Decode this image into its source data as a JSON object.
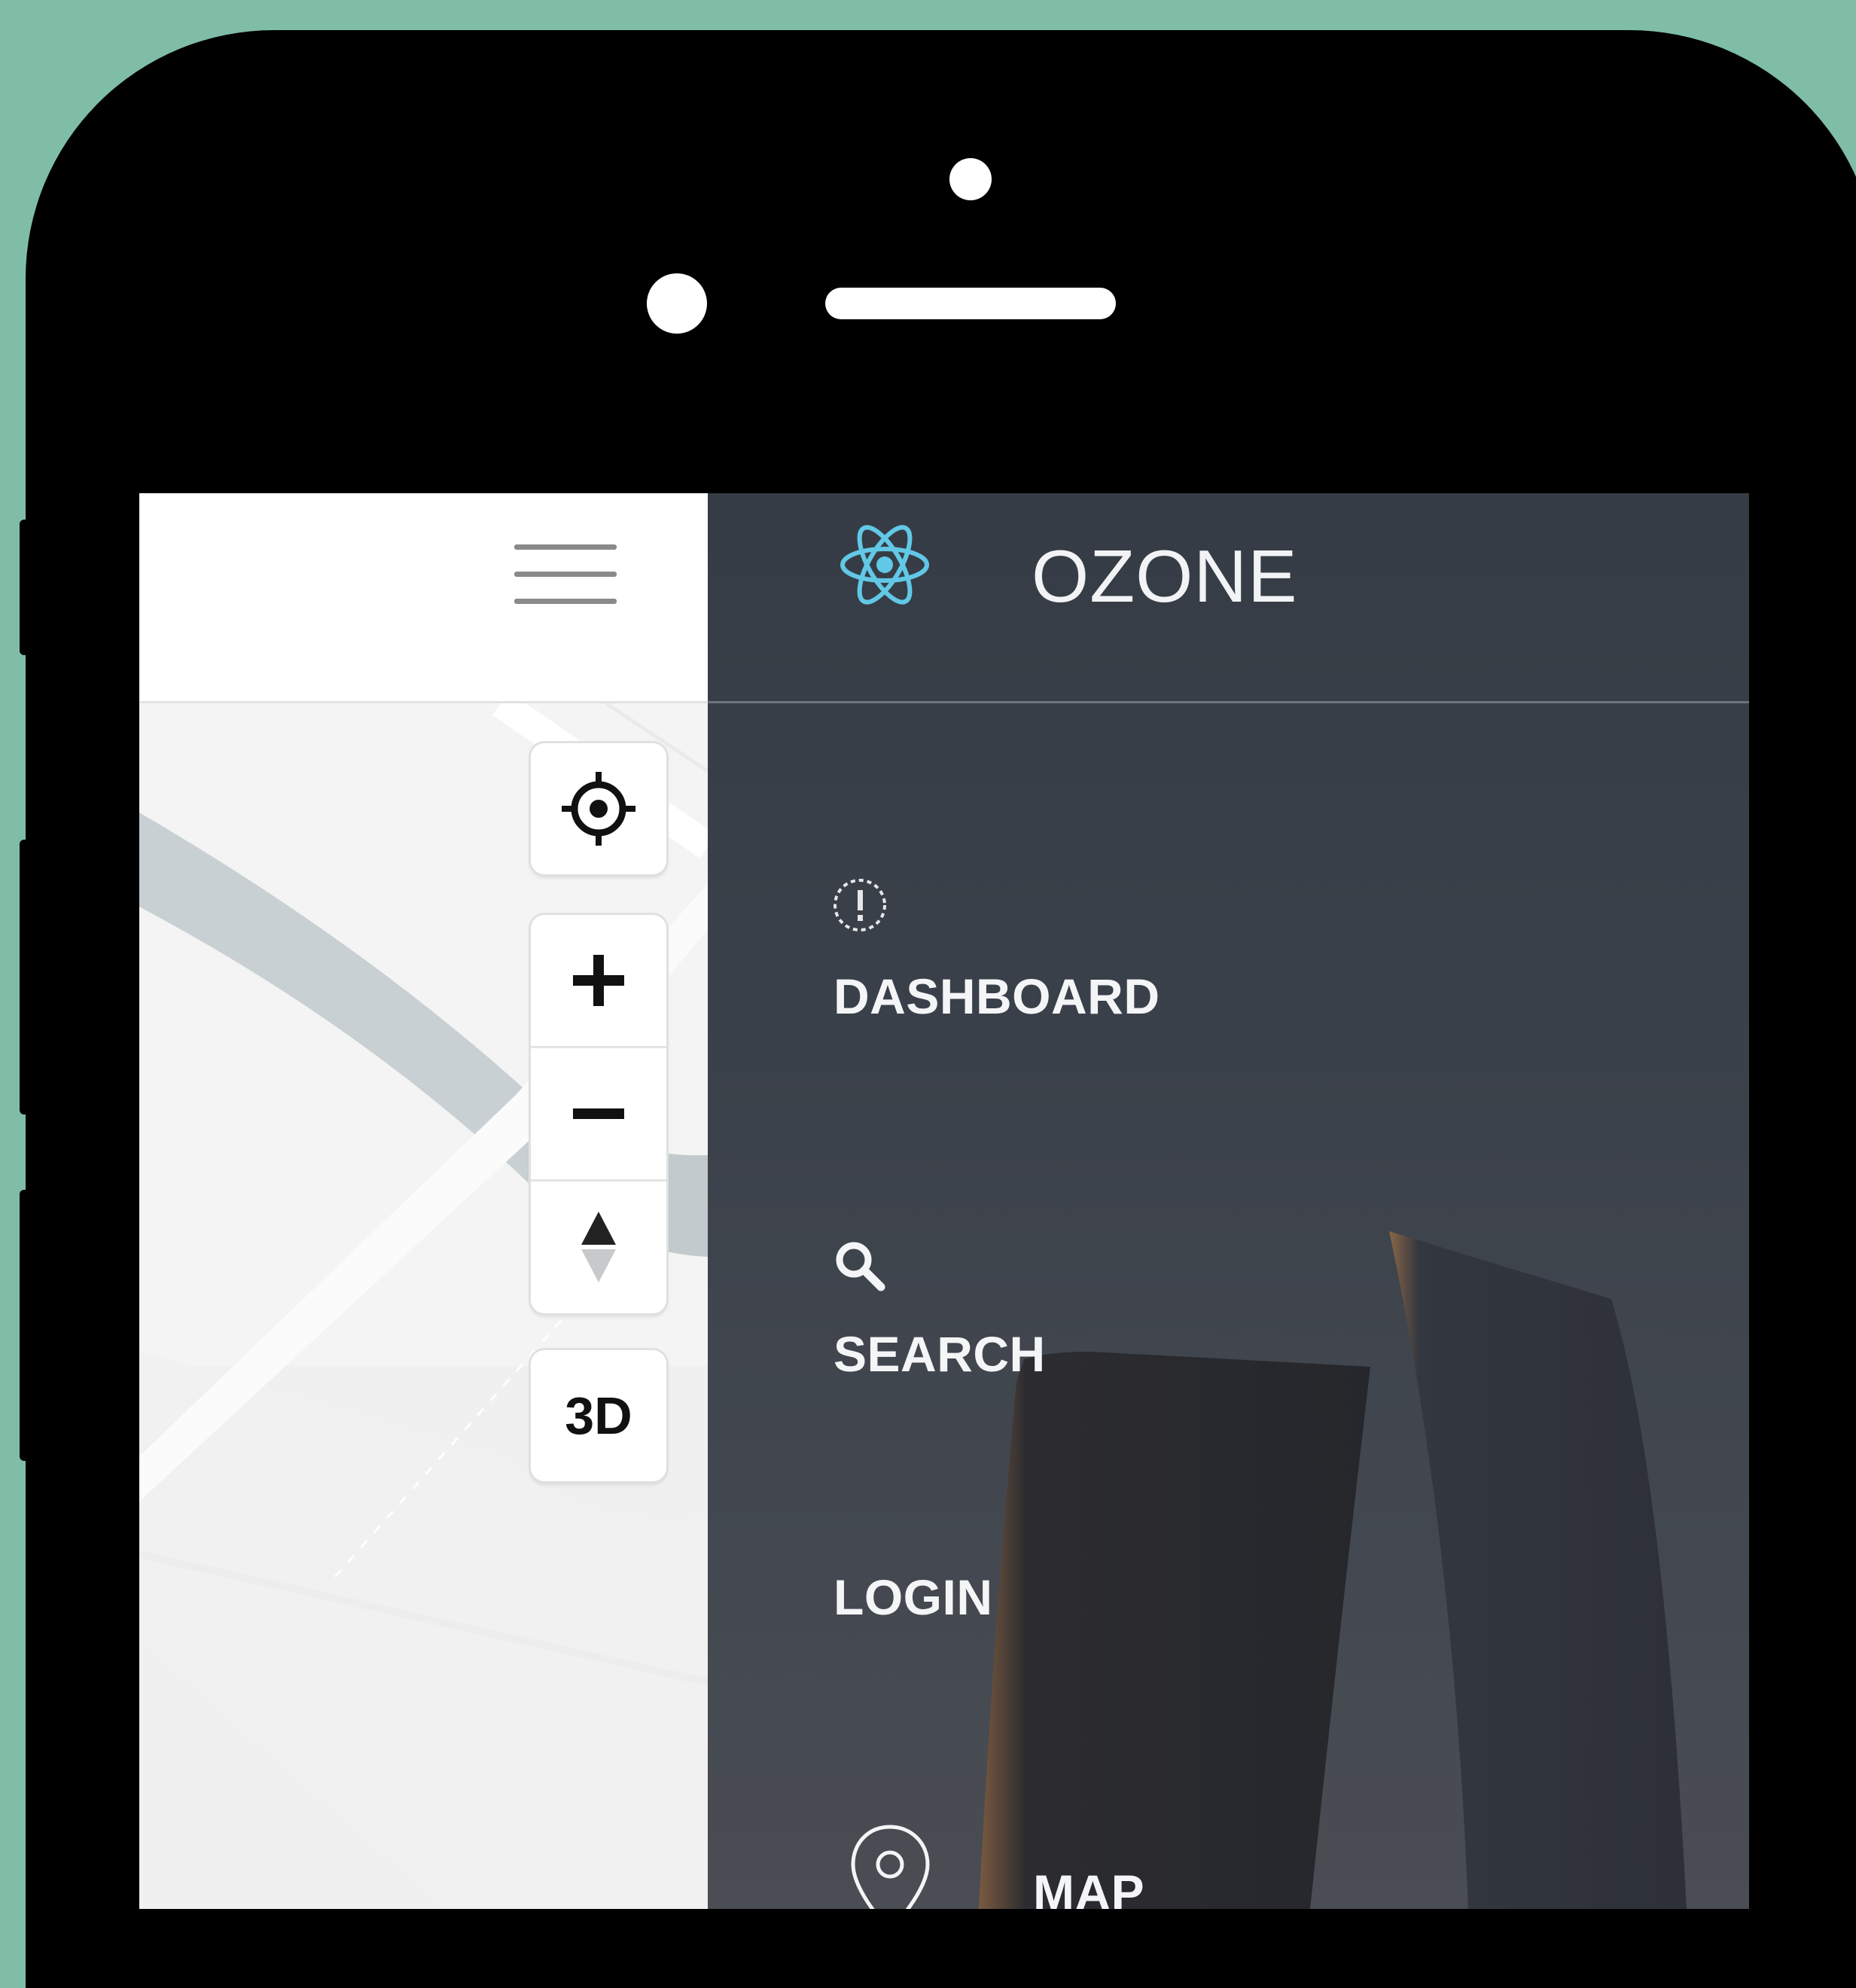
{
  "app": {
    "title": "OZONE"
  },
  "map_controls": {
    "locate_icon": "crosshair-icon",
    "zoom_in_icon": "plus-icon",
    "zoom_out_icon": "minus-icon",
    "compass_icon": "compass-arrows-icon",
    "toggle_3d_label": "3D"
  },
  "drawer": {
    "logo_icon": "react-atom-icon",
    "menu": [
      {
        "label": "DASHBOARD",
        "icon": "alert-circle-icon"
      },
      {
        "label": "SEARCH",
        "icon": "search-icon"
      },
      {
        "label": "LOGIN",
        "icon": ""
      },
      {
        "label": "MAP",
        "icon": "map-pin-icon"
      }
    ]
  },
  "colors": {
    "background": "#7fbda6",
    "drawer": "#3b414a",
    "accent": "#61c8e6",
    "map_water": "#c9d0d3"
  }
}
